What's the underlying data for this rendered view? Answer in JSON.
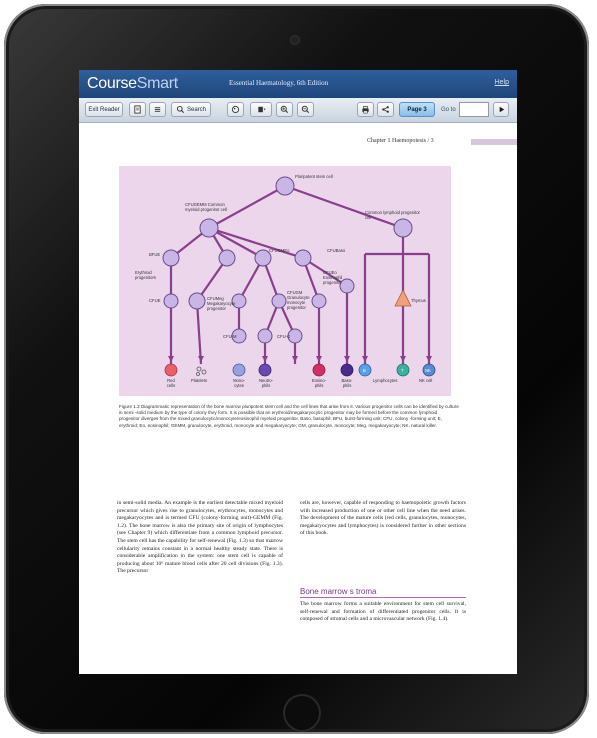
{
  "app": {
    "brand_main": "Course",
    "brand_accent": "Smart",
    "book_title": "Essential Haematology, 6th Edition",
    "help": "Help"
  },
  "toolbar": {
    "exit": "Exit Reader",
    "search": "Search",
    "page_button": "Page 3",
    "goto_label": "Go to",
    "goto_value": ""
  },
  "page": {
    "running_head": "Chapter 1  Haemopoiesis  /   3"
  },
  "figure": {
    "labels": {
      "stem": "Pluripotent stem cell",
      "cfu_gemm": "CFUGEMM Common myeloid progenitor cell",
      "lymph_prog": "Common lymphoid progenitor cell",
      "bfue": "BFUE",
      "erythroid": "Erythroid progenitors",
      "cfue": "CFUE",
      "cfu_meg": "CFUMeg Megakaryocyte progenitor",
      "cfu_gmeo": "CFUGMEo",
      "cfu_gm": "CFUGM Granulocyte monocyte progenitor",
      "cfu_eo": "CFUEo Eosinophil progenitor",
      "cfu_baso": "CFUBaso",
      "cfu_m": "CFU-M",
      "cfu_g": "CFU-G",
      "thymus": "Thymus",
      "red_cells": "Red cells",
      "platelets": "Platelets",
      "monocytes": "Mono-cytes",
      "neutrophils": "Neutro-phils",
      "eosinophils": "Eosino-phils",
      "basophils": "Baso-phils",
      "lymphocytes": "Lymphocytes",
      "nk": "NK cell",
      "b": "B",
      "t": "T",
      "nkl": "NK"
    },
    "caption": "Figure 1.2  Diagrammatic representation of the bone marrow pluripotent stem cell and the cell lines that arise from it. Various progenitor cells can be identified by culture in semi -solid medium by the type of colony they form. It is possible that an erythroid/megakaryocytic progenitor may be formed before the common lymphoid progenitor diverges from the mixed granulocytic/monocyte/eosinophil myeloid progenitor. Baso, basophil; BFU, burst-forming unit; CFU, colony -forming unit; E, erythroid; Eo, eosinophil; GEMM, granulocyte, erythroid, monocyte and megakaryocyte; GM, granulocyte, monocyte; Meg, megakaryocyte; NK, natural killer."
  },
  "body": {
    "col1": "in semi-solid media. An example is the earliest detectable mixed myeloid precursor which gives rise to granulocytes, erythrocytes, monocytes and megakaryocytes and is termed CFU (colony-forming unit)-GEMM (Fig. 1.2). The bone marrow is also the primary site of origin of lymphocytes (see Chapter 9) which differentiate from a common lymphoid precursor. The stem cell has the capability for self-renewal (Fig. 1.3) so that marrow cellularity remains constant in a normal healthy steady state. There is considerable amplification in the system: one stem cell is capable of producing about 10⁶ mature blood cells after 20 cell divisions (Fig. 1.3). The precursor",
    "col2": "cells are, however, capable of responding to haemopoietic growth factors with increased production of one or other cell line when the need arises. The development of the mature cells (red cells, granulocytes, monocytes, megakaryocytes and lymphocytes) is considered further in other sections of this book.",
    "section_heading": "Bone  marrow  s troma",
    "col3": "The bone marrow forms a suitable environment for stem cell survival, self-renewal and formation of differentiated progenitor cells. It is composed of stromal cells and a microvascular network (Fig. 1.4)."
  },
  "colors": {
    "topbar": "#2a5690",
    "figure_bg": "#ebd6ec",
    "tree_line": "#8a3f8c",
    "heading": "#7b3a80"
  }
}
